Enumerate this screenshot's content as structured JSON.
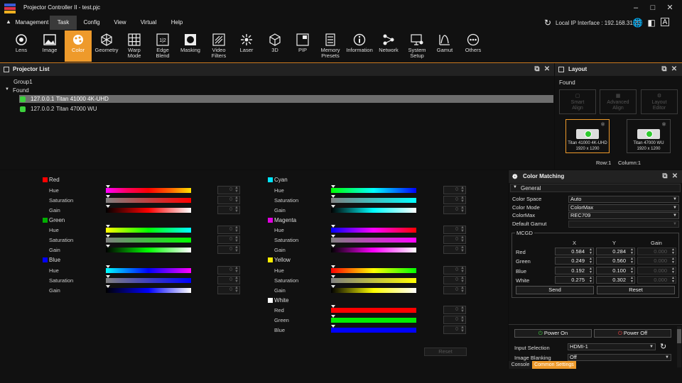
{
  "app": {
    "title": "Projector Controller II - test.pjc"
  },
  "menu": {
    "items": [
      {
        "label": "Management",
        "active": false
      },
      {
        "label": "Task",
        "active": true
      },
      {
        "label": "Config",
        "active": false
      },
      {
        "label": "View",
        "active": false
      },
      {
        "label": "Virtual",
        "active": false
      },
      {
        "label": "Help",
        "active": false
      }
    ],
    "ip_label": "Local IP Interface : 192.168.31.23"
  },
  "ribbon": [
    {
      "label": "Lens",
      "icon": "lens-icon"
    },
    {
      "label": "Image",
      "icon": "image-icon"
    },
    {
      "label": "Color",
      "icon": "color-icon",
      "active": true
    },
    {
      "label": "Geometry",
      "icon": "geometry-icon"
    },
    {
      "label": "Warp Mode",
      "icon": "warp-icon"
    },
    {
      "label": "Edge Blend",
      "icon": "edge-blend-icon"
    },
    {
      "label": "Masking",
      "icon": "masking-icon"
    },
    {
      "label": "Video Filters",
      "icon": "video-filters-icon"
    },
    {
      "label": "Laser",
      "icon": "laser-icon"
    },
    {
      "label": "3D",
      "icon": "cube-icon"
    },
    {
      "label": "PIP",
      "icon": "pip-icon"
    },
    {
      "label": "Memory Presets",
      "icon": "memory-icon"
    },
    {
      "label": "Information",
      "icon": "info-icon"
    },
    {
      "label": "Network",
      "icon": "network-icon"
    },
    {
      "label": "System Setup",
      "icon": "system-setup-icon"
    },
    {
      "label": "Gamut",
      "icon": "gamut-icon"
    },
    {
      "label": "Others",
      "icon": "others-icon"
    }
  ],
  "projector_list": {
    "title": "Projector List",
    "group": "Group1",
    "found_label": "Found",
    "items": [
      {
        "ip": "127.0.0.1",
        "name": "Titan 41000 4K-UHD",
        "selected": true
      },
      {
        "ip": "127.0.0.2",
        "name": "Titan 47000 WU",
        "selected": false
      }
    ]
  },
  "layout": {
    "title": "Layout",
    "found_label": "Found",
    "tools": [
      "Smart Align",
      "Advanced Align",
      "Layout Editor"
    ],
    "tiles": [
      {
        "name": "Titan 41000 4K-UHD",
        "res": "1920 x 1200",
        "selected": true
      },
      {
        "name": "Titan 47000 WU",
        "res": "1920 x 1200",
        "selected": false
      }
    ],
    "row_label": "Row:1",
    "col_label": "Column:1"
  },
  "colors": {
    "row_labels": {
      "hue": "Hue",
      "saturation": "Saturation",
      "gain": "Gain"
    },
    "left": [
      {
        "name": "Red",
        "swatch": "#ff0000",
        "values": [
          "0",
          "0",
          "0"
        ]
      },
      {
        "name": "Green",
        "swatch": "#00b000",
        "values": [
          "0",
          "0",
          "0"
        ]
      },
      {
        "name": "Blue",
        "swatch": "#0000ff",
        "values": [
          "0",
          "0",
          "0"
        ]
      }
    ],
    "right": [
      {
        "name": "Cyan",
        "swatch": "#00e5ff",
        "values": [
          "0",
          "0",
          "0"
        ]
      },
      {
        "name": "Magenta",
        "swatch": "#e000e0",
        "values": [
          "0",
          "0",
          "0"
        ]
      },
      {
        "name": "Yellow",
        "swatch": "#ffee00",
        "values": [
          "0",
          "0",
          "0"
        ]
      }
    ],
    "white": {
      "name": "White",
      "swatch": "#ffffff",
      "rows": [
        {
          "label": "Red",
          "value": "0"
        },
        {
          "label": "Green",
          "value": "0"
        },
        {
          "label": "Blue",
          "value": "0"
        }
      ]
    },
    "reset_label": "Reset"
  },
  "color_matching": {
    "title": "Color Matching",
    "section": "General",
    "fields": [
      {
        "label": "Color Space",
        "value": "Auto"
      },
      {
        "label": "Color Mode",
        "value": "ColorMax"
      },
      {
        "label": "ColorMax",
        "value": "REC709"
      },
      {
        "label": "Default Gamut",
        "value": ""
      }
    ],
    "mcgd_label": "MCGD",
    "columns": [
      "X",
      "Y",
      "Gain"
    ],
    "rows": [
      {
        "label": "Red",
        "x": "0.584",
        "y": "0.284",
        "gain": "0.000"
      },
      {
        "label": "Green",
        "x": "0.249",
        "y": "0.560",
        "gain": "0.000"
      },
      {
        "label": "Blue",
        "x": "0.192",
        "y": "0.100",
        "gain": "0.000"
      },
      {
        "label": "White",
        "x": "0.275",
        "y": "0.302",
        "gain": "0.000"
      }
    ],
    "send_label": "Send",
    "reset_label": "Reset"
  },
  "common": {
    "power_on": "Power On",
    "power_off": "Power Off",
    "input_label": "Input Selection",
    "input_value": "HDMI-1",
    "blank_label": "Image Blanking",
    "blank_value": "Off"
  },
  "tabs": {
    "console": "Console",
    "common": "Common Settings"
  }
}
